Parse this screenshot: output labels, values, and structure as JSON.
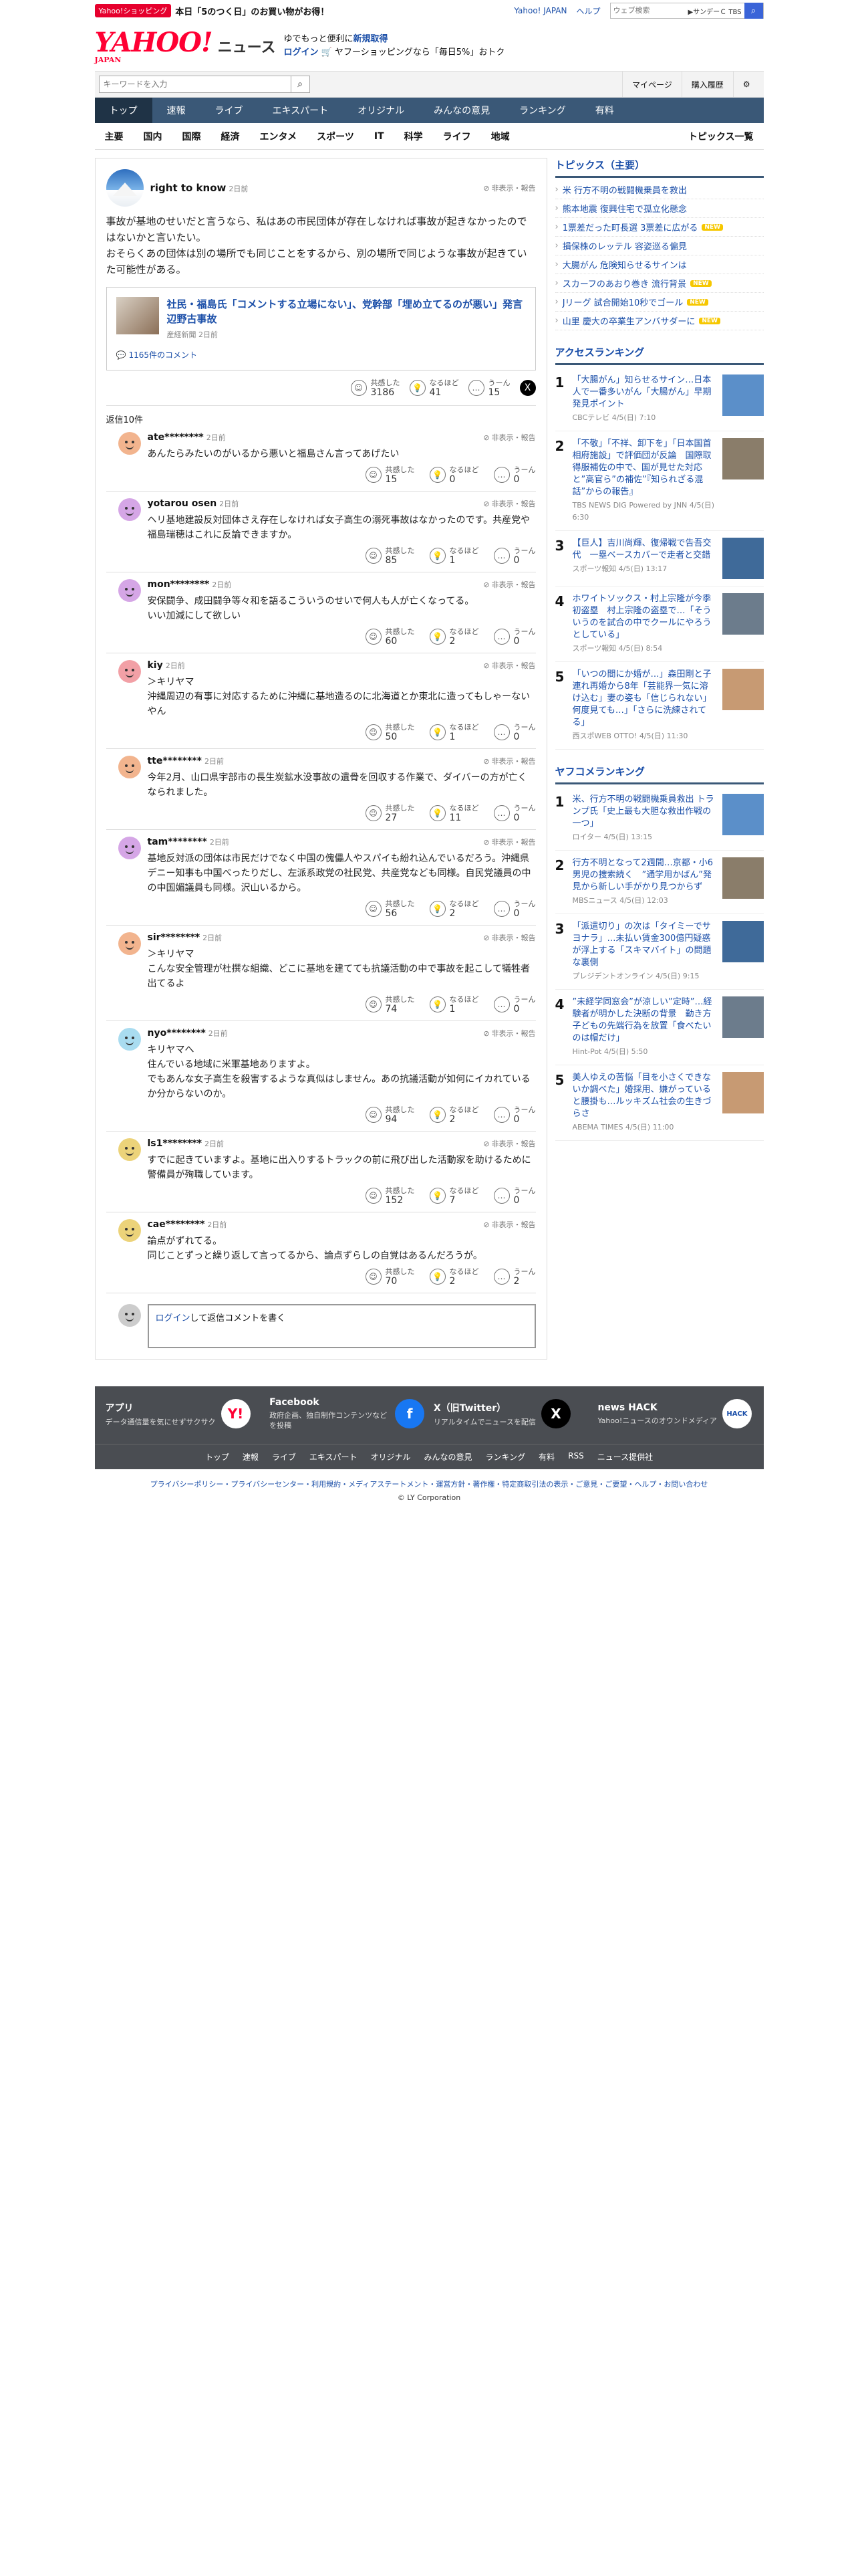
{
  "topbar": {
    "shop_tag": "Yahoo!ショッピング",
    "promo": "本日「5のつく日」のお買い物がお得！",
    "yj": "Yahoo! JAPAN",
    "help": "ヘルプ",
    "web_placeholder": "ウェブ検索",
    "tbs": "▶サンデーＣ TBS",
    "search_btn": "検索"
  },
  "header": {
    "logo": "YAHOO!",
    "logo_sub": "JAPAN",
    "news": "ニュース",
    "msg1": "ゆでもっと便利に",
    "msg1b": "新規取得",
    "msg2a": "ログイン",
    "msg2b": "ヤフーショッピングなら「毎日5%」おトク"
  },
  "search": {
    "placeholder": "キーワードを入力",
    "mypage": "マイページ",
    "history": "購入履歴"
  },
  "gnav": [
    "トップ",
    "速報",
    "ライブ",
    "エキスパート",
    "オリジナル",
    "みんなの意見",
    "ランキング",
    "有料"
  ],
  "snav": [
    "主要",
    "国内",
    "国際",
    "経済",
    "エンタメ",
    "スポーツ",
    "IT",
    "科学",
    "ライフ",
    "地域"
  ],
  "snav_more": "トピックス一覧",
  "post": {
    "name": "right to know",
    "time": "2日前",
    "menu": "非表示・報告",
    "body": "事故が基地のせいだと言うなら、私はあの市民団体が存在しなければ事故が起きなかったのではないかと言いたい。\nおそらくあの団体は別の場所でも同じことをするから、別の場所で同じような事故が起きていた可能性がある。",
    "article": {
      "title": "社民・福島氏「コメントする立場にない」、党幹部「埋め立てるのが悪い」発言　辺野古事故",
      "source": "産経新聞 2日前",
      "comments": "1165件のコメント"
    },
    "reacts": [
      {
        "label": "共感した",
        "n": "3186"
      },
      {
        "label": "なるほど",
        "n": "41"
      },
      {
        "label": "うーん",
        "n": "15"
      }
    ]
  },
  "replies_count": "返信10件",
  "replies": [
    {
      "name": "ate********",
      "time": "2日前",
      "text": "あんたらみたいのがいるから悪いと福島さん言ってあげたい",
      "c": "#f2b48e",
      "r": [
        "15",
        "0",
        "0"
      ]
    },
    {
      "name": "yotarou osen",
      "time": "2日前",
      "text": "ヘリ基地建設反対団体さえ存在しなければ女子高生の溺死事故はなかったのです。共産党や福島瑞穂はこれに反論できますか。",
      "c": "#d5a6e6",
      "r": [
        "85",
        "1",
        "0"
      ]
    },
    {
      "name": "mon********",
      "time": "2日前",
      "text": "安保闘争、成田闘争等々和を語るこういうのせいで何人も人が亡くなってる。\nいい加減にして欲しい",
      "c": "#d5a6e6",
      "r": [
        "60",
        "2",
        "0"
      ]
    },
    {
      "name": "kiy",
      "time": "2日前",
      "text": "＞キリヤマ\n沖縄周辺の有事に対応するために沖縄に基地造るのに北海道とか東北に造ってもしゃーないやん",
      "c": "#f2a0a6",
      "r": [
        "50",
        "1",
        "0"
      ]
    },
    {
      "name": "tte********",
      "time": "2日前",
      "text": "今年2月、山口県宇部市の長生炭鉱水没事故の遺骨を回収する作業で、ダイバーの方が亡くなられました。",
      "c": "#f2b48e",
      "r": [
        "27",
        "11",
        "0"
      ]
    },
    {
      "name": "tam********",
      "time": "2日前",
      "text": "基地反対派の団体は市民だけでなく中国の傀儡人やスパイも紛れ込んでいるだろう。沖縄県デニー知事も中国べったりだし、左派系政党の社民党、共産党なども同様。自民党議員の中の中国媚議員も同様。沢山いるから。",
      "c": "#d5a6e6",
      "r": [
        "56",
        "2",
        "0"
      ]
    },
    {
      "name": "sir********",
      "time": "2日前",
      "text": "＞キリヤマ\nこんな安全管理が杜撰な組織、どこに基地を建てても抗議活動の中で事故を起こして犠牲者出てるよ",
      "c": "#f2b48e",
      "r": [
        "74",
        "1",
        "0"
      ]
    },
    {
      "name": "nyo********",
      "time": "2日前",
      "text": "キリヤマへ\n住んでいる地域に米軍基地ありますよ。\nでもあんな女子高生を殺害するような真似はしません。あの抗議活動が如何にイカれているか分からないのか。",
      "c": "#a9dcf0",
      "r": [
        "94",
        "2",
        "0"
      ]
    },
    {
      "name": "ls1********",
      "time": "2日前",
      "text": "すでに起きていますよ。基地に出入りするトラックの前に飛び出した活動家を助けるために警備員が殉職しています。",
      "c": "#ecd37a",
      "r": [
        "152",
        "7",
        "0"
      ]
    },
    {
      "name": "cae********",
      "time": "2日前",
      "text": "論点がずれてる。\n同じことずっと繰り返して言ってるから、論点ずらしの自覚はあるんだろうが。",
      "c": "#ecd37a",
      "r": [
        "70",
        "2",
        "2"
      ]
    }
  ],
  "reply_box": {
    "login": "ログイン",
    "text": "して返信コメントを書く"
  },
  "topics": {
    "title": "トピックス（主要）",
    "items": [
      {
        "t": "米 行方不明の戦闘機乗員を救出",
        "new": false
      },
      {
        "t": "熊本地震 復興住宅で孤立化懸念",
        "new": false
      },
      {
        "t": "1票差だった町長選 3票差に広がる",
        "new": true
      },
      {
        "t": "損保株のレッテル 容姿巡る偏見",
        "new": false
      },
      {
        "t": "大腸がん 危険知らせるサインは",
        "new": false
      },
      {
        "t": "スカーフのあおり巻き 流行背景",
        "new": true
      },
      {
        "t": "Jリーグ 試合開始10秒でゴール",
        "new": true
      },
      {
        "t": "山里 慶大の卒業生アンバサダーに",
        "new": true
      }
    ]
  },
  "access": {
    "title": "アクセスランキング",
    "items": [
      {
        "no": "1",
        "t": "「大腸がん」知らせるサイン…日本人で一番多いがん「大腸がん」早期発見ポイント",
        "s": "CBCテレビ 4/5(日) 7:10"
      },
      {
        "no": "2",
        "t": "「不敬」「不祥、卸下を」「日本国首相府施設」で評価団が反論　国際取得服補佐の中で、国が見せた対応と”高官ら”の補佐”『知られざる混話”からの報告』",
        "s": "TBS NEWS DIG Powered by JNN 4/5(日) 6:30"
      },
      {
        "no": "3",
        "t": "【巨人】吉川尚輝、復帰戦で告吾交代　一塁ベースカバーで走者と交錯",
        "s": "スポーツ報知 4/5(日) 13:17"
      },
      {
        "no": "4",
        "t": "ホワイトソックス・村上宗隆が今季初盗塁　村上宗隆の盗塁で…「そういうのを試合の中でクールにやろうとしている」",
        "s": "スポーツ報知 4/5(日) 8:54"
      },
      {
        "no": "5",
        "t": "「いつの間にか婚が…」森田剛と子連れ再婚から8年「芸能界一気に溶け込む」妻の姿も「信じられない」何度見ても…」「さらに洗練されてる」",
        "s": "西スポWEB OTTO! 4/5(日) 11:30"
      }
    ]
  },
  "yafuko": {
    "title": "ヤフコメランキング",
    "items": [
      {
        "no": "1",
        "t": "米、行方不明の戦闘機乗員救出 トランプ氏「史上最も大胆な救出作戦の一つ」",
        "s": "ロイター 4/5(日) 13:15"
      },
      {
        "no": "2",
        "t": "行方不明となって2週間…京都・小6男児の捜索続く　”通学用かばん”発見から新しい手がかり見つからず",
        "s": "MBSニュース 4/5(日) 12:03"
      },
      {
        "no": "3",
        "t": "「派遣切り」の次は「タイミーでサヨナラ」…未払い賃金300億円疑惑が浮上する「スキマバイト」の問題な裏側",
        "s": "プレジデントオンライン 4/5(日) 9:15"
      },
      {
        "no": "4",
        "t": "”未経学同窓会”が涼しい”定時”…経験者が明かした決断の背景　勤き方子どもの先端行為を放置「食べたいのは帽だけ」",
        "s": "Hint-Pot 4/5(日) 5:50"
      },
      {
        "no": "5",
        "t": "美人ゆえの苦悩「目を小さくできないか調べた」婚採用、嫌がっていると腰掛も…ルッキズム社会の生きづらさ",
        "s": "ABEMA TIMES 4/5(日) 11:00"
      }
    ]
  },
  "footer": {
    "items": [
      {
        "t": "アプリ",
        "d": "データ通信量を気にせずサクサク",
        "ic": "Y!"
      },
      {
        "t": "Facebook",
        "d": "政府企画、独自制作コンテンツなどを投稿",
        "ic": "f"
      },
      {
        "t": "X（旧Twitter）",
        "d": "リアルタイムでニュースを配信",
        "ic": "X"
      },
      {
        "t": "news HACK",
        "d": "Yahoo!ニュースのオウンドメディア",
        "ic": "HACK"
      }
    ],
    "links": [
      "トップ",
      "速報",
      "ライブ",
      "エキスパート",
      "オリジナル",
      "みんなの意見",
      "ランキング",
      "有料",
      "RSS",
      "ニュース提供社"
    ],
    "legal": "プライバシーポリシー・プライバシーセンター・利用規約・メディアステートメント・運営方針・著作権・特定商取引法の表示・ご意見・ご要望・ヘルプ・お問い合わせ",
    "copy": "© LY Corporation"
  }
}
